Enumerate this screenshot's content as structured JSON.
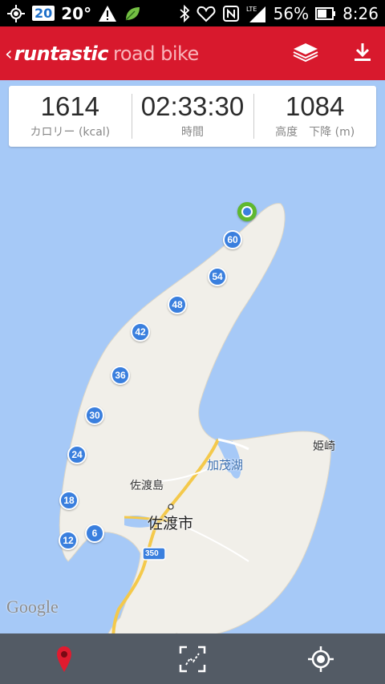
{
  "statusbar": {
    "badge": "20",
    "temperature": "20°",
    "lte": "LTE",
    "battery": "56%",
    "time": "8:26"
  },
  "appbar": {
    "brand": "runtastic",
    "brand_sub": "road bike"
  },
  "stats": [
    {
      "value": "1614",
      "label": "カロリー (kcal)"
    },
    {
      "value": "02:33:30",
      "label": "時間"
    },
    {
      "value": "1084",
      "label_a": "高度",
      "label_b": "下降 (m)"
    }
  ],
  "map": {
    "labels": {
      "island": "佐渡島",
      "city": "佐渡市",
      "lake": "加茂湖",
      "cape": "姫崎",
      "route": "350"
    },
    "markers": [
      "60",
      "54",
      "48",
      "42",
      "36",
      "30",
      "24",
      "18",
      "12",
      "6"
    ],
    "attribution": "Google"
  },
  "colors": {
    "accent": "#d8192d",
    "marker": "#3a7fde",
    "start": "#5fb82f",
    "water": "#a6c9f7",
    "land": "#f1efe9"
  },
  "icons": {
    "layers": "layers-icon",
    "download": "download-icon",
    "pin": "location-pin-icon",
    "fit": "fit-route-icon",
    "gps": "my-location-icon"
  }
}
